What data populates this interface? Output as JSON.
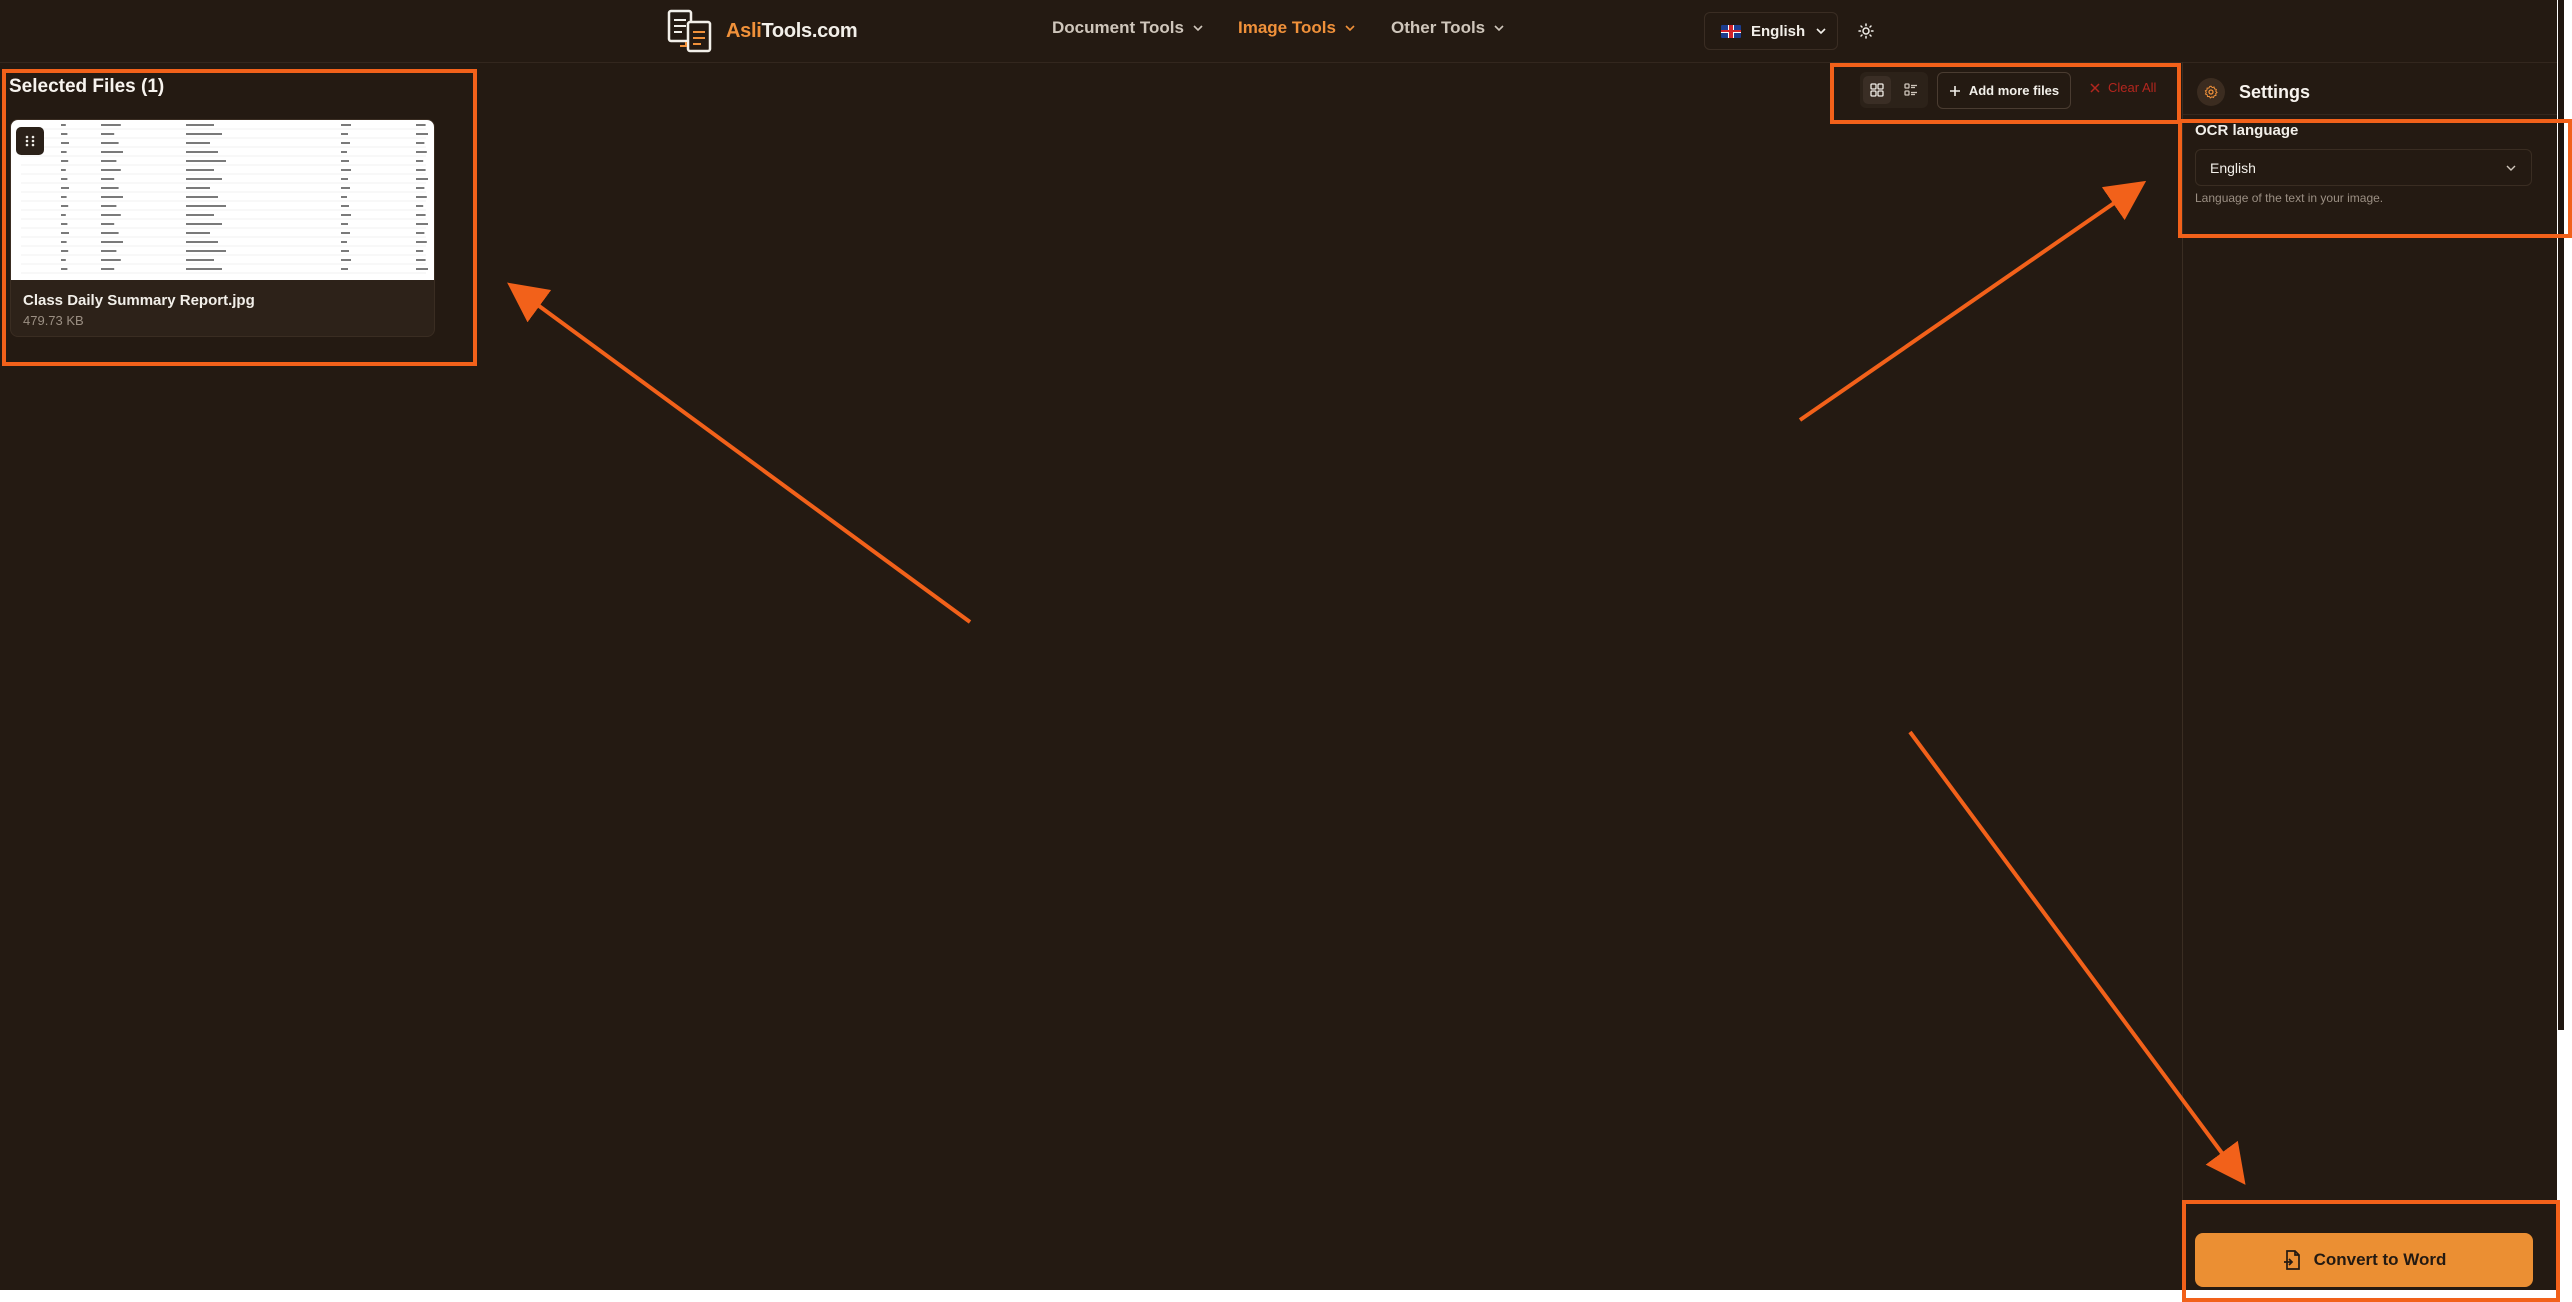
{
  "brand": {
    "prefix": "Asli",
    "suffix": "Tools.com"
  },
  "nav": [
    {
      "label": "Document Tools",
      "active": false
    },
    {
      "label": "Image Tools",
      "active": true
    },
    {
      "label": "Other Tools",
      "active": false
    }
  ],
  "language": {
    "label": "English"
  },
  "files": {
    "title": "Selected Files (1)",
    "items": [
      {
        "name": "Class Daily Summary Report.jpg",
        "size": "479.73 KB"
      }
    ]
  },
  "toolbar": {
    "add_label": "Add more files",
    "clear_label": "Clear All"
  },
  "settings": {
    "title": "Settings",
    "ocr_label": "OCR language",
    "ocr_value": "English",
    "ocr_help": "Language of the text in your image."
  },
  "convert": {
    "label": "Convert to Word"
  },
  "colors": {
    "background": "#241a12",
    "accent": "#f0913a",
    "annotation": "#f2611a",
    "danger": "#b3261e"
  }
}
